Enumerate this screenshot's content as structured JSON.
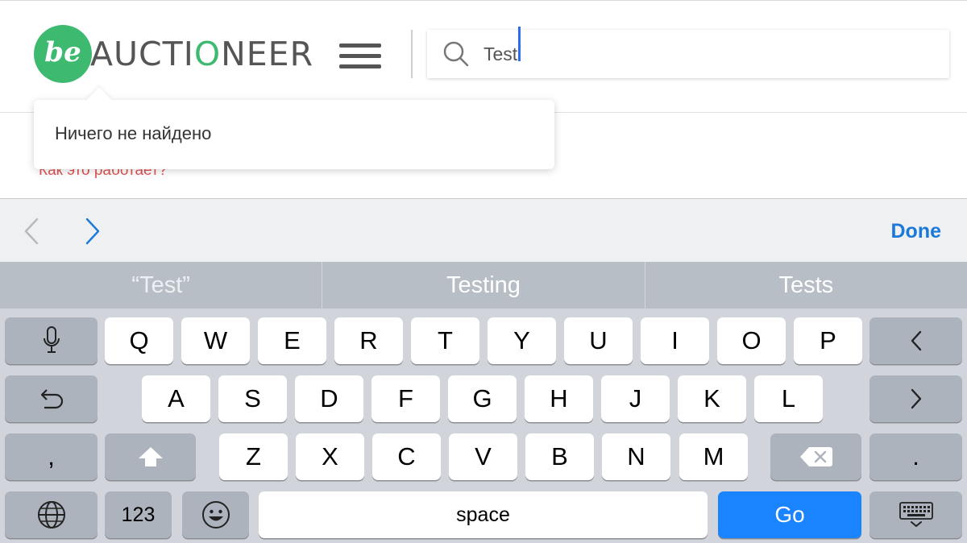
{
  "header": {
    "logo_mark": "be",
    "logo_word_1": "AUCTI",
    "logo_word_2": "O",
    "logo_word_3": "NEER",
    "menu_icon": "hamburger-icon",
    "search": {
      "icon": "search-icon",
      "value": "Test"
    }
  },
  "popup": {
    "message": "Ничего не найдено"
  },
  "page": {
    "how_link": "Как это работает?"
  },
  "accessory": {
    "prev_icon": "chevron-left-icon",
    "next_icon": "chevron-right-icon",
    "done_label": "Done"
  },
  "suggestions": [
    "“Test”",
    "Testing",
    "Tests"
  ],
  "keyboard": {
    "row1": [
      "Q",
      "W",
      "E",
      "R",
      "T",
      "Y",
      "U",
      "I",
      "O",
      "P"
    ],
    "row2": [
      "A",
      "S",
      "D",
      "F",
      "G",
      "H",
      "J",
      "K",
      "L"
    ],
    "row3": [
      "Z",
      "X",
      "C",
      "V",
      "B",
      "N",
      "M"
    ],
    "comma": ",",
    "period": ".",
    "numbers_label": "123",
    "space_label": "space",
    "go_label": "Go",
    "icons": [
      "microphone-icon",
      "undo-icon",
      "shift-icon",
      "globe-icon",
      "emoji-icon",
      "cursor-left-icon",
      "cursor-right-icon",
      "backspace-icon",
      "keyboard-dismiss-icon"
    ]
  },
  "colors": {
    "brand_green": "#3dba6f",
    "link_red": "#e05555",
    "go_blue": "#1a84ff",
    "done_blue": "#1a79d9",
    "caret_blue": "#2d6cf0"
  }
}
